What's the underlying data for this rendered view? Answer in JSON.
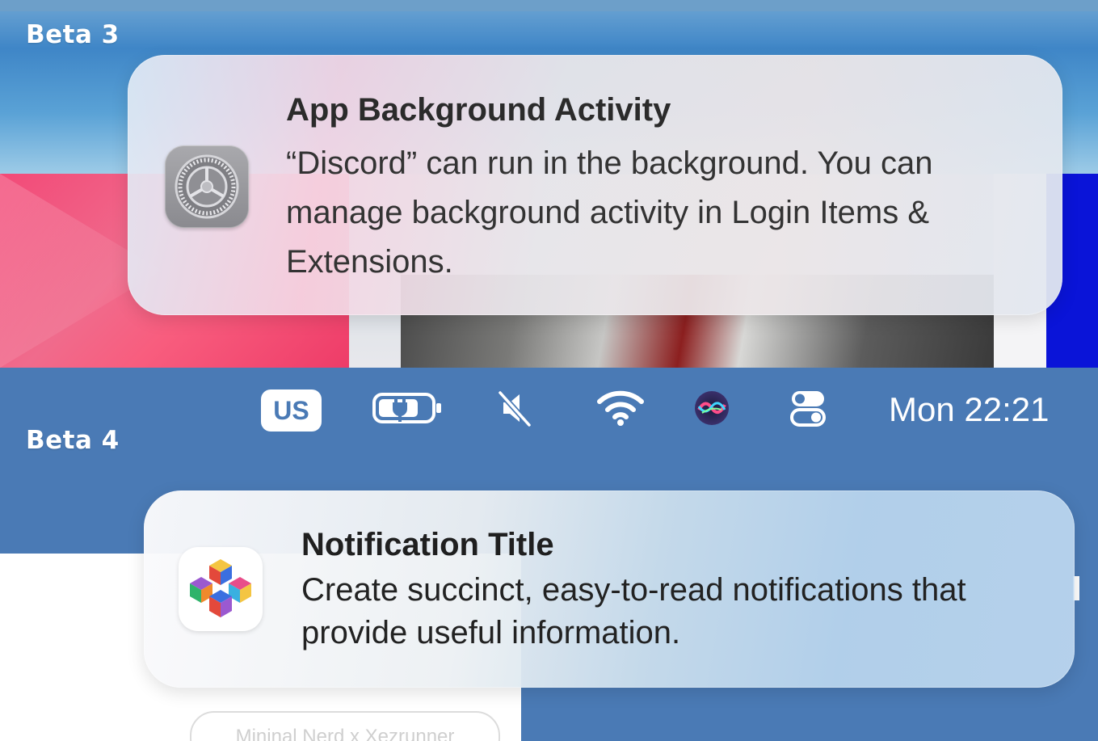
{
  "beta3": {
    "label": "Beta 3",
    "notification": {
      "title": "App Background Activity",
      "body": "“Discord” can run in the background. You can manage background activity in Login Items & Extensions.",
      "icon": "gear-icon"
    }
  },
  "beta4": {
    "label": "Beta 4",
    "menubar": {
      "input_source": "US",
      "icons": [
        "battery-charging-icon",
        "speaker-muted-icon",
        "wifi-icon",
        "siri-icon",
        "control-center-icon"
      ],
      "clock": "Mon 22:21"
    },
    "notification": {
      "title": "Notification Title",
      "body": "Create succinct, easy-to-read notifications that provide useful information.",
      "icon": "cube-icon"
    },
    "background_button": "Mininal Nerd x Xezrunner"
  },
  "colors": {
    "menubar_bg": "#4a7ab5",
    "pink_accent": "#f24a78",
    "blue_accent": "#0a14d8"
  }
}
